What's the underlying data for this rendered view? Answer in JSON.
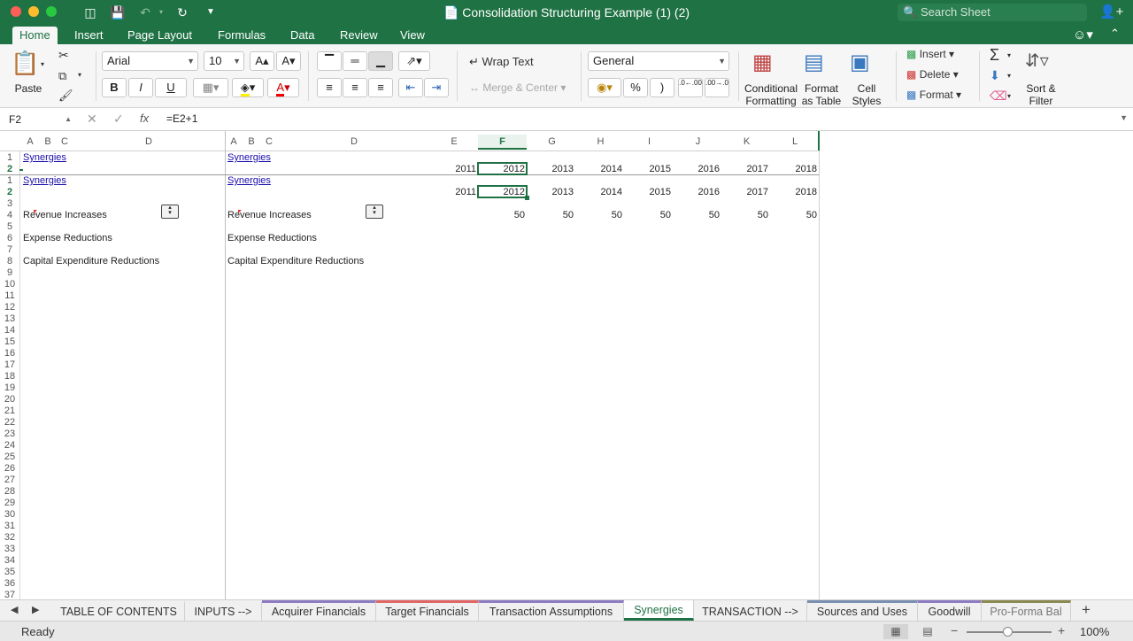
{
  "window": {
    "title": "Consolidation Structuring Example (1) (2)",
    "search_placeholder": "Search Sheet"
  },
  "ribbon_tabs": [
    "Home",
    "Insert",
    "Page Layout",
    "Formulas",
    "Data",
    "Review",
    "View"
  ],
  "active_ribbon_tab": "Home",
  "ribbon": {
    "paste": "Paste",
    "font_name": "Arial",
    "font_size": "10",
    "bold": "B",
    "italic": "I",
    "underline": "U",
    "wrap_text": "Wrap Text",
    "merge_center": "Merge & Center",
    "number_format": "General",
    "percent": "%",
    "comma": ")",
    "conditional_formatting": [
      "Conditional",
      "Formatting"
    ],
    "format_as_table": [
      "Format",
      "as Table"
    ],
    "cell_styles": [
      "Cell",
      "Styles"
    ],
    "insert": "Insert",
    "delete": "Delete",
    "format": "Format",
    "sort_filter": [
      "Sort &",
      "Filter"
    ],
    "increase_decimal": ".0←.00",
    "decrease_decimal": ".00→.0"
  },
  "formula_bar": {
    "name_box": "F2",
    "formula": "=E2+1"
  },
  "grid": {
    "frozen_columns": [
      "A",
      "B",
      "C",
      "D"
    ],
    "scroll_columns": [
      "A",
      "B",
      "C",
      "D",
      "E",
      "F",
      "G",
      "H",
      "I",
      "J",
      "K",
      "L"
    ],
    "selected_column": "F",
    "frozen_rows": [
      "1",
      "2"
    ],
    "rows": [
      "1",
      "2",
      "3",
      "4",
      "5",
      "6",
      "7",
      "8",
      "9",
      "10",
      "11",
      "12",
      "13",
      "14",
      "15",
      "16",
      "17",
      "18",
      "19",
      "20",
      "21",
      "22",
      "23",
      "24",
      "25",
      "26",
      "27",
      "28",
      "29",
      "30",
      "31",
      "32",
      "33",
      "34",
      "35",
      "36",
      "37"
    ],
    "selected_row": "2",
    "title_link": "Synergies",
    "years": [
      "2011",
      "2012",
      "2013",
      "2014",
      "2015",
      "2016",
      "2017",
      "2018"
    ],
    "labels": {
      "revenue": "Revenue Increases",
      "expense": "Expense Reductions",
      "capex": "Capital Expenditure Reductions"
    },
    "revenue_values": [
      "50",
      "50",
      "50",
      "50",
      "50",
      "50",
      "50"
    ]
  },
  "sheet_tabs": [
    {
      "label": "TABLE OF CONTENTS",
      "color": ""
    },
    {
      "label": "INPUTS -->",
      "color": ""
    },
    {
      "label": "Acquirer Financials",
      "color": "#8e7cc3"
    },
    {
      "label": "Target Financials",
      "color": "#e06666"
    },
    {
      "label": "Transaction Assumptions",
      "color": "#8e7cc3"
    },
    {
      "label": "Synergies",
      "color": "#1f7244"
    },
    {
      "label": "TRANSACTION -->",
      "color": ""
    },
    {
      "label": "Sources and Uses",
      "color": "#7a8fb0"
    },
    {
      "label": "Goodwill",
      "color": "#8e7cc3"
    },
    {
      "label": "Pro-Forma Bal",
      "color": "#8a8a50"
    }
  ],
  "active_sheet": "Synergies",
  "status": {
    "text": "Ready",
    "zoom": "100%"
  }
}
